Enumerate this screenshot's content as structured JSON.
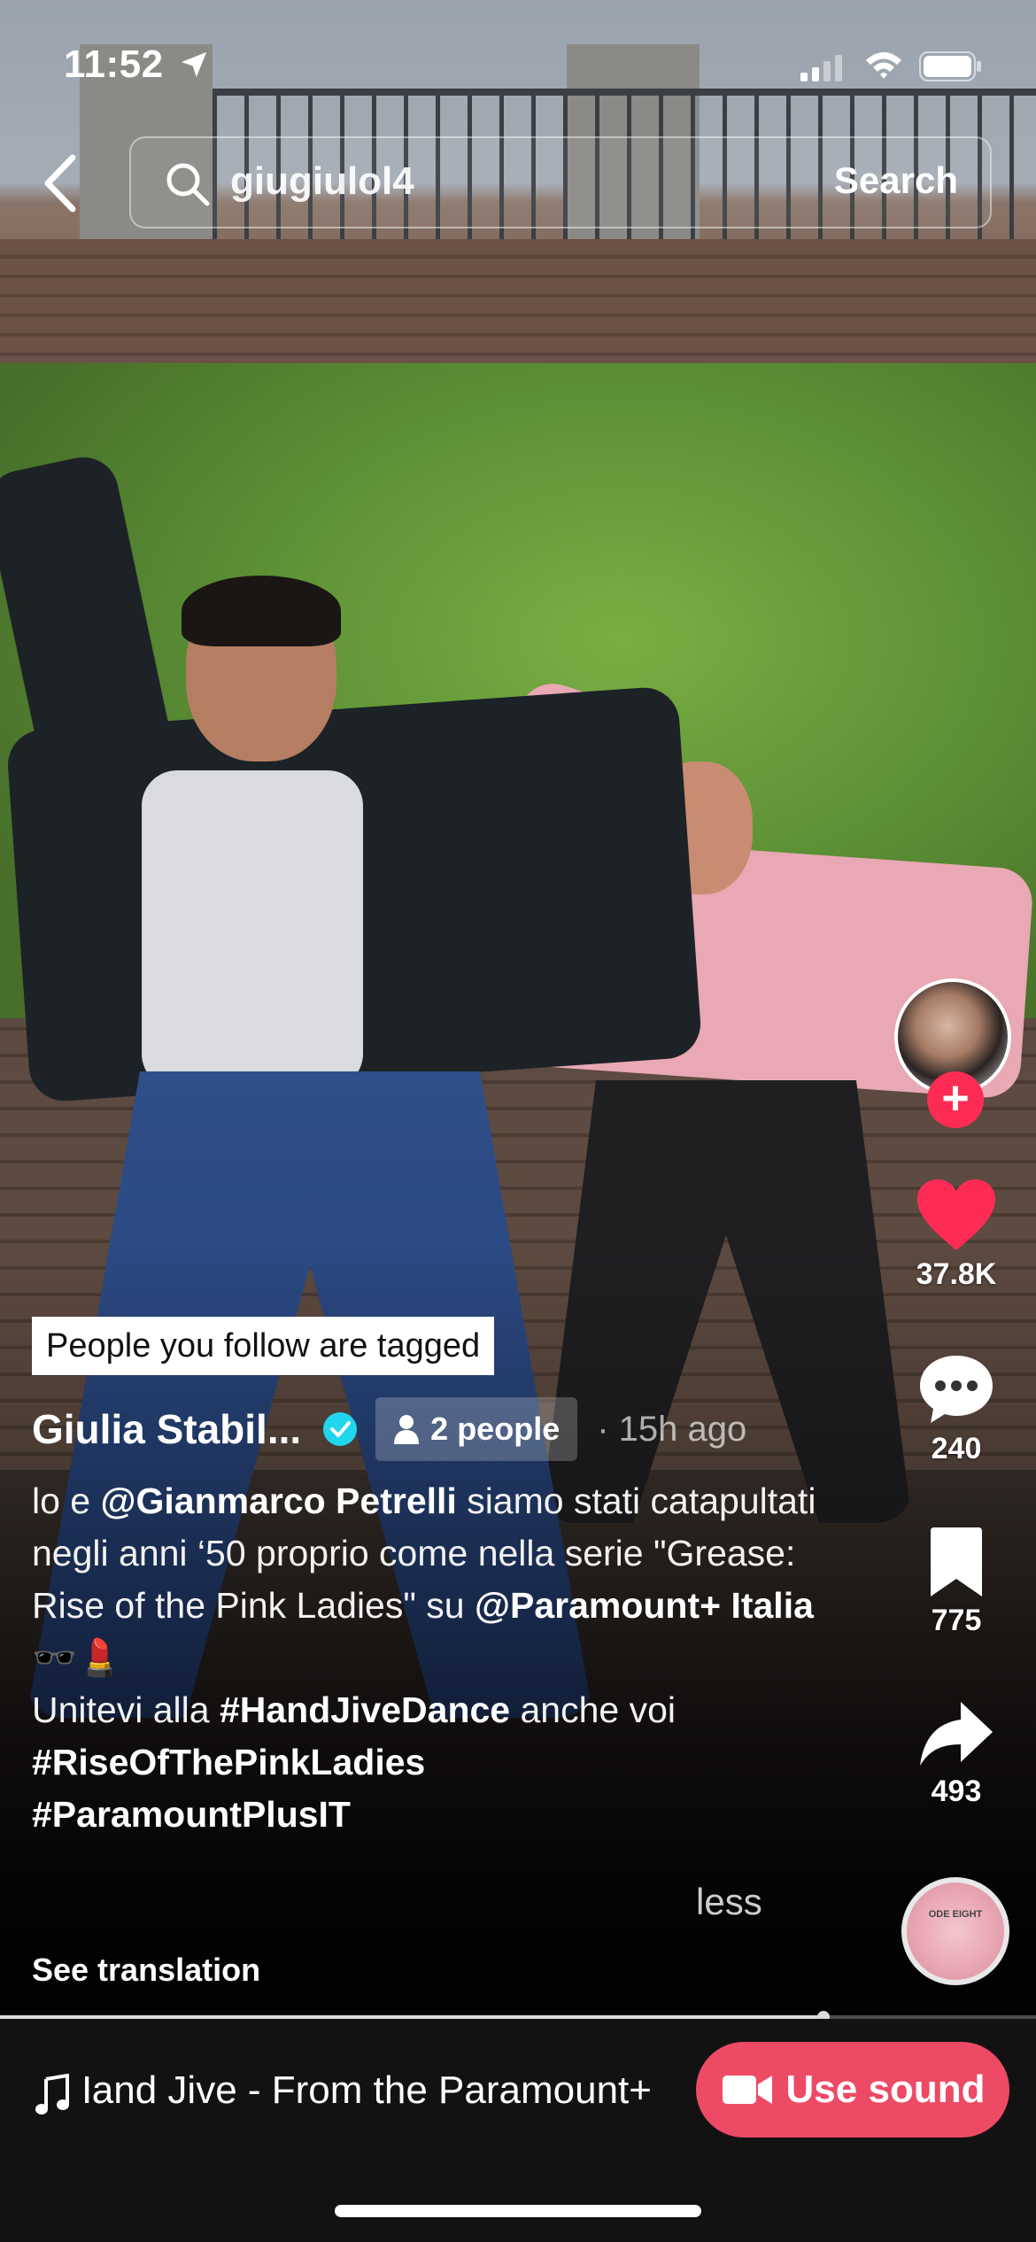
{
  "status_bar": {
    "time": "11:52"
  },
  "search": {
    "query": "giugiulol4",
    "button_label": "Search"
  },
  "rail": {
    "likes": "37.8K",
    "comments": "240",
    "bookmarks": "775",
    "shares": "493",
    "disc_text": "ODE EIGHT"
  },
  "post": {
    "tag_banner": "People you follow are tagged",
    "author": "Giulia Stabil...",
    "people_tagged": "2 people",
    "time_ago": "· 15h ago",
    "caption": {
      "p1": "lo e ",
      "mention1": "@Gianmarco Petrelli",
      "p2": "  siamo stati catapultati negli anni ‘50 proprio come nella serie \"Grease: Rise of the Pink Ladies\" su ",
      "mention2": "@Paramount+ Italia",
      "emoji": " 🕶️💄",
      "p3": "Unitevi alla ",
      "hashtag1": "#HandJiveDance",
      "p4": " anche voi",
      "hashtag2": "#RiseOfThePinkLadies",
      "hashtag3": "#ParamountPlusIT"
    },
    "less_label": "less",
    "see_translation": "See translation"
  },
  "playback": {
    "progress": 0.795
  },
  "sound": {
    "title": "Hand Jive - From the Paramount+ Series",
    "use_sound_label": "Use sound"
  },
  "colors": {
    "accent": "#fe2c55",
    "use_sound_bg": "#ed4a66",
    "verified": "#20d5ec"
  }
}
